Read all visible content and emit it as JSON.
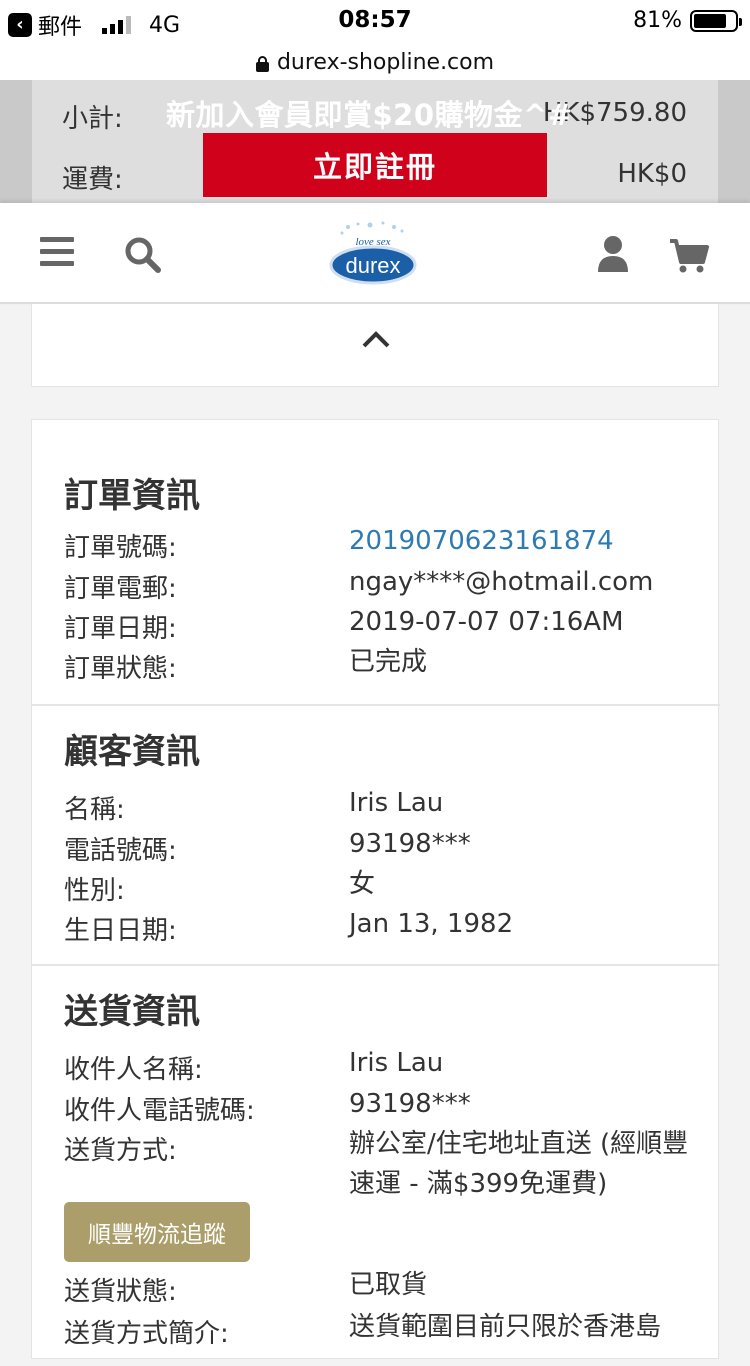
{
  "status_bar": {
    "back_app": "郵件",
    "network": "4G",
    "time": "08:57",
    "battery": "81%",
    "battery_level": 0.81
  },
  "browser": {
    "url": "durex-shopline.com"
  },
  "summary": {
    "subtotal_label": "小計:",
    "subtotal_value": "HK$759.80",
    "shipping_label": "運費:",
    "shipping_value": "HK$0",
    "promo_text": "新加入會員即賞$20購物金^#",
    "register_button": "立即註冊"
  },
  "header": {
    "menu_icon": "hamburger-icon",
    "search_icon": "search-icon",
    "logo_tagline": "love sex",
    "logo_text": "durex",
    "account_icon": "user-icon",
    "cart_icon": "cart-icon",
    "brand_blue": "#1a5fa8"
  },
  "collapse": {
    "icon": "chevron-up-icon"
  },
  "order_info": {
    "title": "訂單資訊",
    "rows": [
      {
        "label": "訂單號碼:",
        "value": "2019070623161874"
      },
      {
        "label": "訂單電郵:",
        "value": "ngay****@hotmail.com"
      },
      {
        "label": "訂單日期:",
        "value": "2019-07-07 07:16AM"
      },
      {
        "label": "訂單狀態:",
        "value": "已完成"
      }
    ]
  },
  "customer_info": {
    "title": "顧客資訊",
    "rows": [
      {
        "label": "名稱:",
        "value": "Iris Lau"
      },
      {
        "label": "電話號碼:",
        "value": "93198***"
      },
      {
        "label": "性別:",
        "value": "女"
      },
      {
        "label": "生日日期:",
        "value": "Jan 13, 1982"
      }
    ]
  },
  "delivery_info": {
    "title": "送貨資訊",
    "rows": [
      {
        "label": "收件人名稱:",
        "value": "Iris Lau"
      },
      {
        "label": "收件人電話號碼:",
        "value": "93198***"
      },
      {
        "label": "送貨方式:",
        "value": "辦公室/住宅地址直送 (經順豐速運 - 滿$399免運費)"
      },
      {
        "label": "送貨狀態:",
        "value": "已取貨"
      },
      {
        "label": "送貨方式簡介:",
        "value": "送貨範圍目前只限於香港島"
      }
    ],
    "track_button": "順豐物流追蹤"
  },
  "colors": {
    "accent_red": "#d0021b",
    "link_blue": "#2e7bb3",
    "track_gold": "#ab9e6a"
  }
}
